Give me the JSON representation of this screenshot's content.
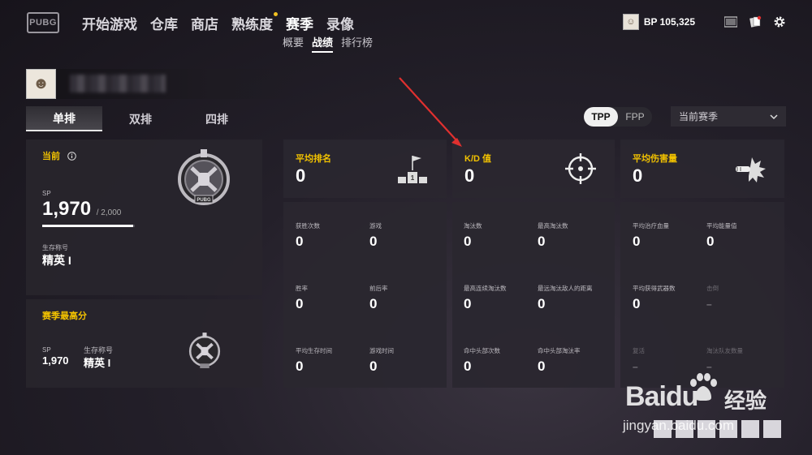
{
  "app": {
    "logo_text": "PUBG"
  },
  "nav": {
    "items": [
      {
        "label": "开始游戏"
      },
      {
        "label": "仓库"
      },
      {
        "label": "商店"
      },
      {
        "label": "熟练度"
      },
      {
        "label": "赛季"
      },
      {
        "label": "录像"
      }
    ],
    "active": "赛季",
    "sub_items": [
      {
        "label": "概要"
      },
      {
        "label": "战绩"
      },
      {
        "label": "排行榜"
      }
    ],
    "sub_active": "战绩"
  },
  "topbar": {
    "bp_label": "BP 105,325",
    "icons": [
      "barcode-icon",
      "cards-icon",
      "gear-icon"
    ]
  },
  "modes": {
    "tabs": [
      {
        "label": "单排"
      },
      {
        "label": "双排"
      },
      {
        "label": "四排"
      }
    ],
    "active": "单排"
  },
  "perspective": {
    "options": [
      "TPP",
      "FPP"
    ],
    "active": "TPP"
  },
  "season_select": {
    "value": "当前赛季"
  },
  "current": {
    "title": "当前",
    "sp_label": "SP",
    "sp_value": "1,970",
    "sp_max": "/ 2,000",
    "sp_progress": 0.985,
    "tier_label": "生存称号",
    "tier_value": "精英 I"
  },
  "season_best": {
    "title": "赛季最高分",
    "sp_label": "SP",
    "sp_value": "1,970",
    "tier_label": "生存称号",
    "tier_value": "精英 I"
  },
  "headline": [
    {
      "title": "平均排名",
      "value": "0",
      "icon": "podium-flag-icon"
    },
    {
      "title": "K/D 值",
      "value": "0",
      "icon": "crosshair-icon"
    },
    {
      "title": "平均伤害量",
      "value": "0",
      "icon": "bullet-impact-icon"
    }
  ],
  "col1": [
    {
      "label": "获胜次数",
      "value": "0"
    },
    {
      "label": "游戏",
      "value": "0"
    },
    {
      "label": "胜率",
      "value": "0"
    },
    {
      "label": "前后率",
      "value": "0"
    },
    {
      "label": "平均生存时间",
      "value": "0"
    },
    {
      "label": "游戏时间",
      "value": "0"
    }
  ],
  "col2": [
    {
      "label": "淘汰数",
      "value": "0"
    },
    {
      "label": "最高淘汰数",
      "value": "0"
    },
    {
      "label": "最高连续淘汰数",
      "value": "0"
    },
    {
      "label": "最远淘汰敌人的距离",
      "value": "0"
    },
    {
      "label": "命中头部次数",
      "value": "0"
    },
    {
      "label": "命中头部淘汰率",
      "value": "0"
    }
  ],
  "col3": [
    {
      "label": "平均治疗血量",
      "value": "0"
    },
    {
      "label": "平均能量值",
      "value": "0"
    },
    {
      "label": "平均获得武器数",
      "value": "0"
    },
    {
      "label": "击倒",
      "value": "–"
    },
    {
      "label": "复活",
      "value": "–"
    },
    {
      "label": "淘汰队友数量",
      "value": "–"
    }
  ],
  "watermark": {
    "brand": "Baidu",
    "brand_cn": "经验",
    "url": "jingyan.baidu.com"
  },
  "colors": {
    "accent": "#f2c200",
    "arrow": "#e0302f"
  }
}
